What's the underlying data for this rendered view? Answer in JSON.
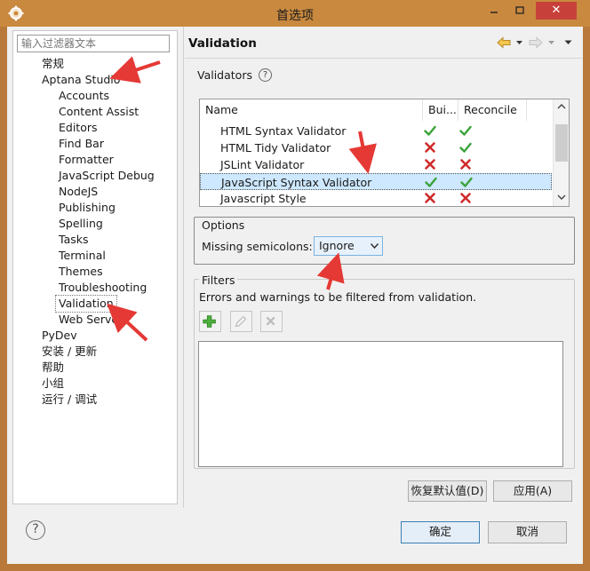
{
  "window": {
    "title": "首选项",
    "close_glyph": "✕"
  },
  "left": {
    "filter_placeholder": "输入过滤器文本",
    "tree": [
      {
        "label": "常规",
        "level": 1
      },
      {
        "label": "Aptana Studio",
        "level": 1
      },
      {
        "label": "Accounts",
        "level": 2
      },
      {
        "label": "Content Assist",
        "level": 2
      },
      {
        "label": "Editors",
        "level": 2
      },
      {
        "label": "Find Bar",
        "level": 2
      },
      {
        "label": "Formatter",
        "level": 2
      },
      {
        "label": "JavaScript Debug",
        "level": 2
      },
      {
        "label": "NodeJS",
        "level": 2
      },
      {
        "label": "Publishing",
        "level": 2
      },
      {
        "label": "Spelling",
        "level": 2
      },
      {
        "label": "Tasks",
        "level": 2
      },
      {
        "label": "Terminal",
        "level": 2
      },
      {
        "label": "Themes",
        "level": 2
      },
      {
        "label": "Troubleshooting",
        "level": 2
      },
      {
        "label": "Validation",
        "level": 2,
        "selected": true
      },
      {
        "label": "Web Server",
        "level": 2
      },
      {
        "label": "PyDev",
        "level": 1
      },
      {
        "label": "安装 / 更新",
        "level": 1
      },
      {
        "label": "帮助",
        "level": 1
      },
      {
        "label": "小组",
        "level": 1
      },
      {
        "label": "运行 / 调试",
        "level": 1
      }
    ]
  },
  "page": {
    "title": "Validation",
    "validators_label": "Validators",
    "help_glyph": "?",
    "table": {
      "columns": [
        "Name",
        "Bui...",
        "Reconcile"
      ],
      "rows": [
        {
          "name": "HTML Syntax Validator",
          "build": "check",
          "reconcile": "check"
        },
        {
          "name": "HTML Tidy Validator",
          "build": "cross",
          "reconcile": "check"
        },
        {
          "name": "JSLint Validator",
          "build": "cross",
          "reconcile": "cross"
        },
        {
          "name": "JavaScript Syntax Validator",
          "build": "check",
          "reconcile": "check",
          "selected": true
        },
        {
          "name": "Javascript Style",
          "build": "cross",
          "reconcile": "cross"
        }
      ]
    },
    "options": {
      "title": "Options",
      "missing_semicolons_label": "Missing semicolons:",
      "missing_semicolons_value": "Ignore"
    },
    "filters": {
      "title": "Filters",
      "description": "Errors and warnings to be filtered from validation."
    },
    "restore_defaults_button": "恢复默认值(D)",
    "apply_button": "应用(A)"
  },
  "footer": {
    "help_glyph": "?",
    "ok_button": "确定",
    "cancel_button": "取消"
  },
  "colors": {
    "titlebar": "#c9893f",
    "close": "#c7413a",
    "selection": "#cde8ff",
    "check": "#3aa33a",
    "cross": "#d02b2b",
    "annotation_arrow": "#e53935"
  }
}
